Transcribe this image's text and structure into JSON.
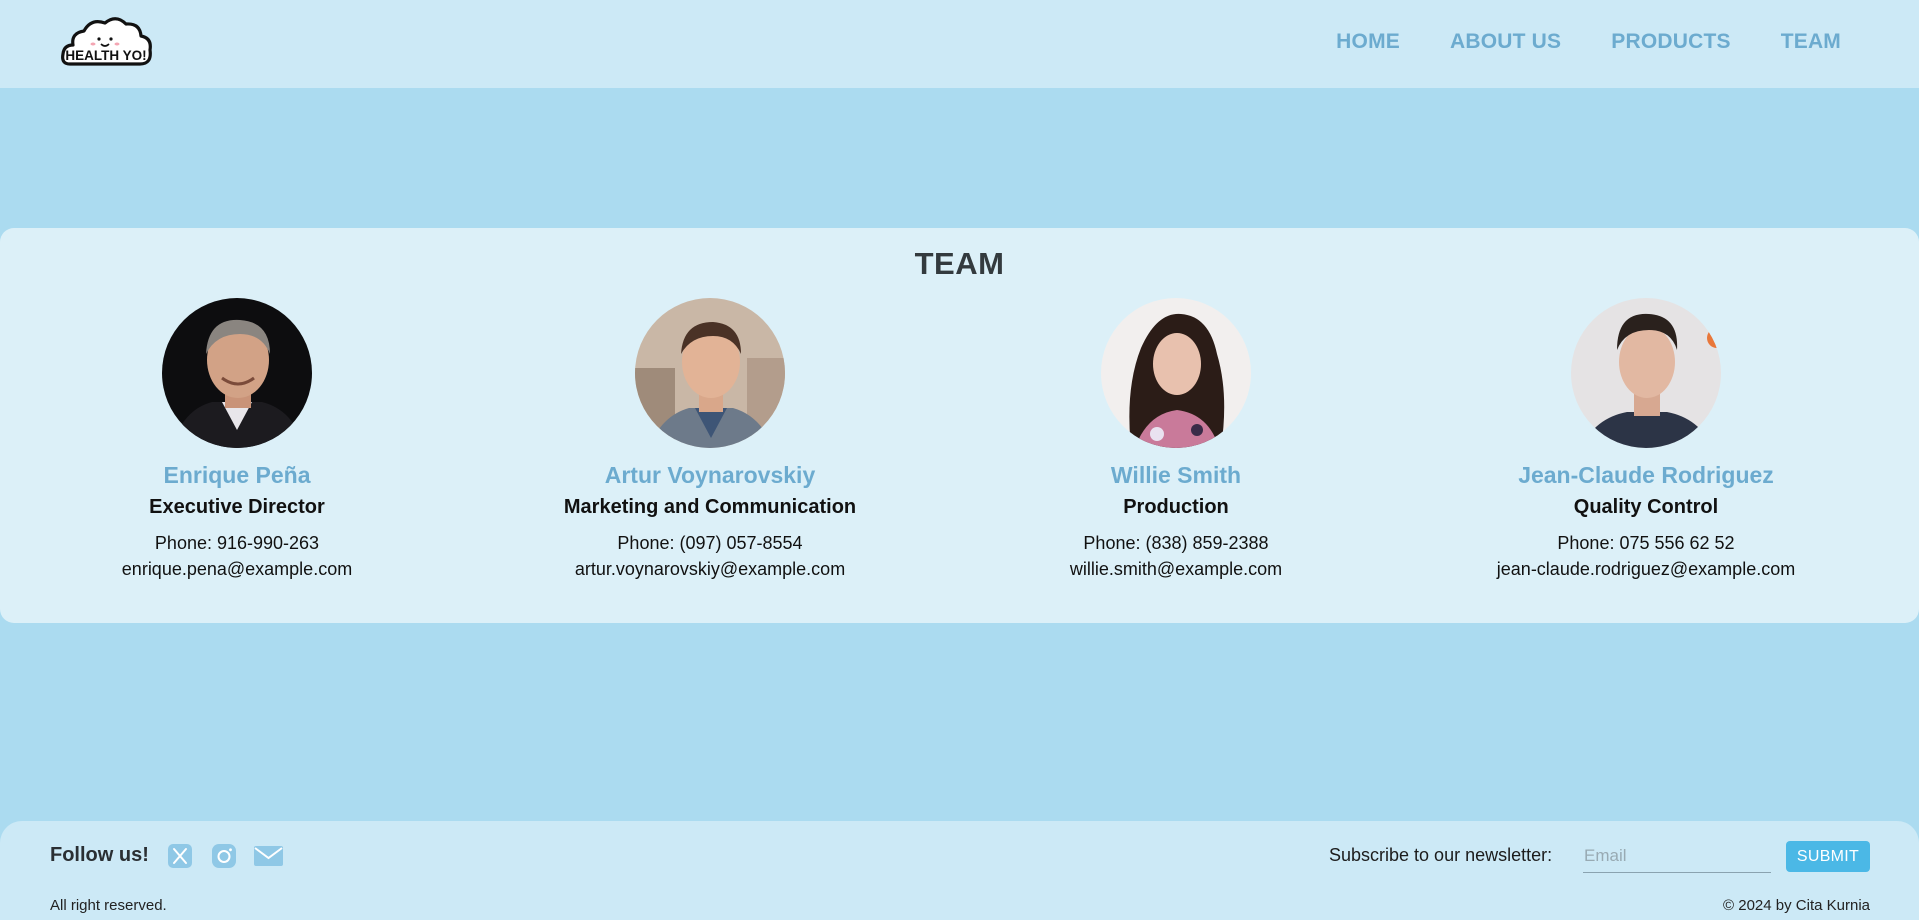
{
  "header": {
    "logo_text": "HEALTH YO!",
    "nav": [
      {
        "label": "HOME"
      },
      {
        "label": "ABOUT US"
      },
      {
        "label": "PRODUCTS"
      },
      {
        "label": "TEAM"
      }
    ]
  },
  "team": {
    "title": "TEAM",
    "members": [
      {
        "name": "Enrique Peña",
        "role": "Executive Director",
        "phone": "Phone: 916-990-263",
        "email": "enrique.pena@example.com"
      },
      {
        "name": "Artur Voynarovskiy",
        "role": "Marketing and Communication",
        "phone": "Phone: (097) 057-8554",
        "email": "artur.voynarovskiy@example.com"
      },
      {
        "name": "Willie Smith",
        "role": "Production",
        "phone": "Phone: (838) 859-2388",
        "email": "willie.smith@example.com"
      },
      {
        "name": "Jean-Claude Rodriguez",
        "role": "Quality Control",
        "phone": "Phone: 075 556 62 52",
        "email": "jean-claude.rodriguez@example.com"
      }
    ]
  },
  "footer": {
    "follow_label": "Follow us!",
    "social_icons": [
      "x-icon",
      "instagram-icon",
      "mail-icon"
    ],
    "newsletter_label": "Subscribe to our newsletter:",
    "email_placeholder": "Email",
    "submit_label": "SUBMIT",
    "rights": "All right reserved.",
    "copyright": "© 2024 by Cita Kurnia"
  },
  "colors": {
    "page_bg": "#abdbf0",
    "header_bg": "#cce9f6",
    "panel_bg": "#dcf0f8",
    "accent": "#6cabcf",
    "button": "#4bb8e6"
  }
}
